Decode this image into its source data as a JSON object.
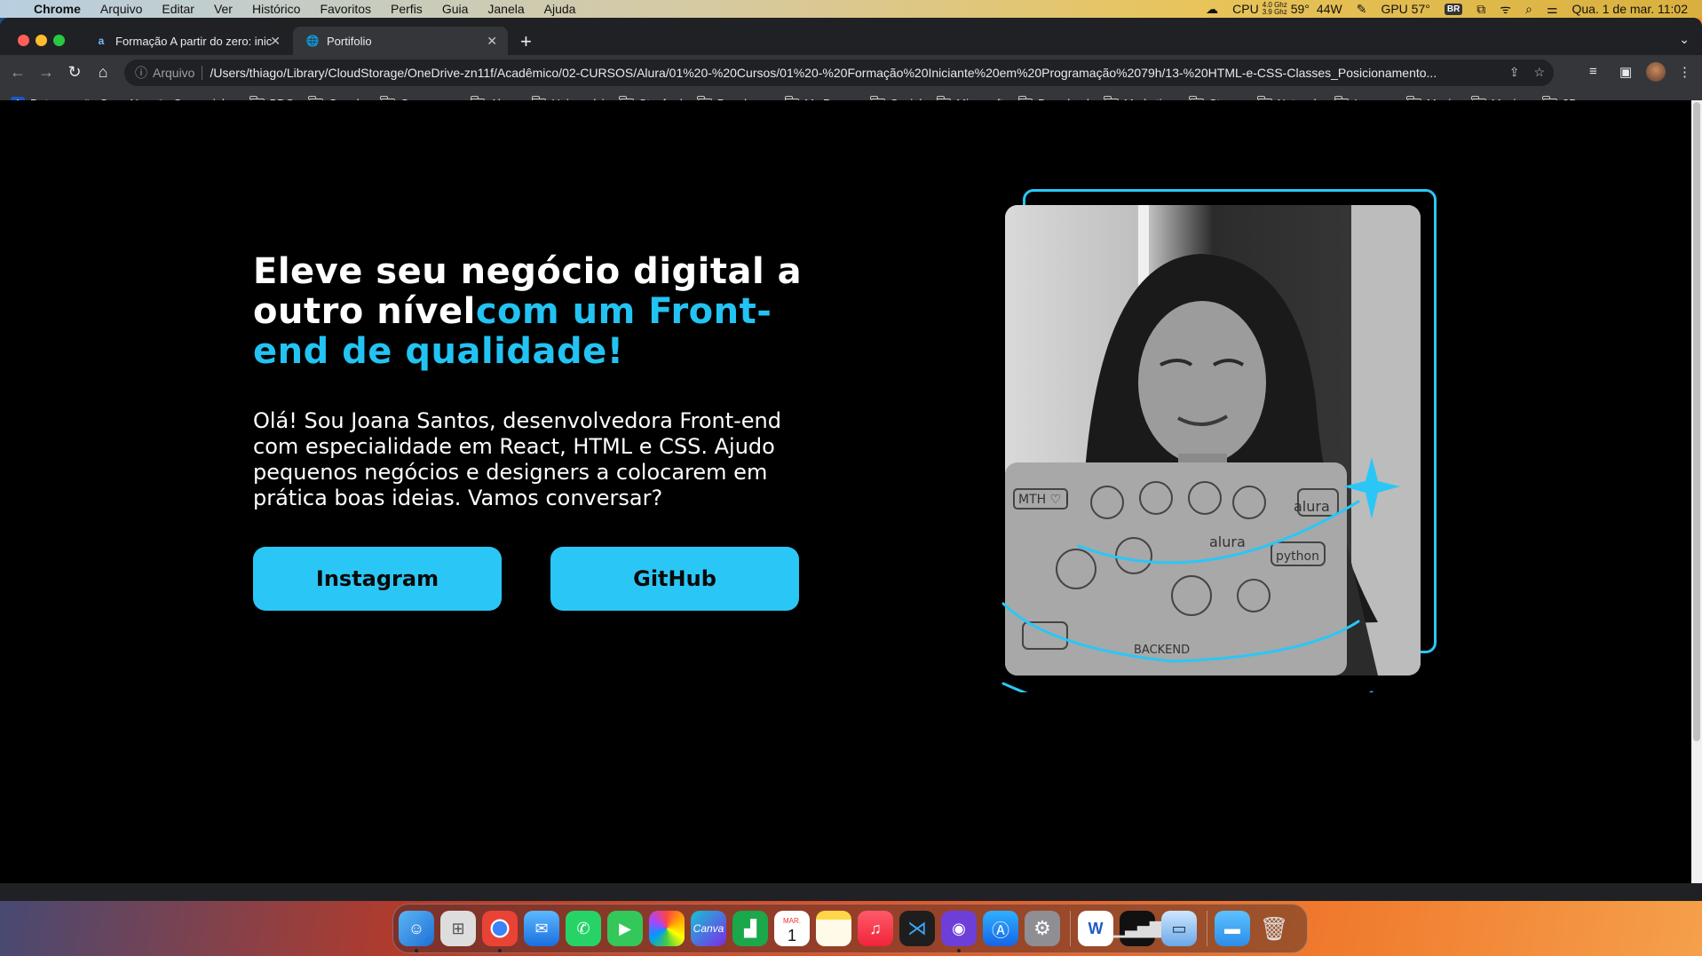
{
  "menubar": {
    "app": "Chrome",
    "menus": [
      "Arquivo",
      "Editar",
      "Ver",
      "Histórico",
      "Favoritos",
      "Perfis",
      "Guia",
      "Janela",
      "Ajuda"
    ],
    "cpu_label": "CPU",
    "cpu_freq_top": "4.0 Ghz",
    "cpu_freq_bottom": "3.9 Ghz",
    "cpu_temp": "59°",
    "power": "44W",
    "gpu_label": "GPU",
    "gpu_temp": "57°",
    "keyboard": "BR",
    "datetime": "Qua. 1 de mar.  11:02"
  },
  "tabs": [
    {
      "title": "Formação A partir do zero: inic",
      "icon": "a"
    },
    {
      "title": "Portifolio",
      "icon": "globe"
    }
  ],
  "omnibox": {
    "scheme_label": "Arquivo",
    "url": "/Users/thiago/Library/CloudStorage/OneDrive-zn11f/Acadêmico/02-CURSOS/Alura/01%20-%20Cursos/01%20-%20Formação%20Iniciante%20em%20Programação%2079h/13-%20HTML-e-CSS-Classes_Posicionamento..."
  },
  "bookmarks": [
    "Detran",
    "OpenAI",
    "Cavaquinho",
    "BDC",
    "Google",
    "Concursos",
    "Alura",
    "Uniasselvi",
    "Stanford",
    "Developer",
    "My Pages",
    "Social",
    "Microsoft",
    "Download",
    "Marketing",
    "Steam",
    "Network",
    "Images",
    "Music",
    "Movies",
    "3D"
  ],
  "hero": {
    "headline_white": "Eleve seu negócio digital a outro nível",
    "headline_blue": "com um Front-end de qualidade!",
    "bio": "Olá! Sou Joana Santos, desenvolvedora Front-end com especialidade em React, HTML e CSS. Ajudo pequenos negócios e designers a colocarem em prática boas ideias. Vamos conversar?",
    "btn_instagram": "Instagram",
    "btn_github": "GitHub"
  },
  "dock": {
    "calendar_month": "MAR.",
    "calendar_day": "1",
    "apps": [
      "finder",
      "launchpad",
      "chrome",
      "mail",
      "whatsapp",
      "facetime",
      "photos",
      "canva",
      "numbers",
      "calendar",
      "notes",
      "music",
      "vscode",
      "github-desktop",
      "app-store",
      "system-settings",
      "word",
      "activity-monitor",
      "preview",
      "downloads",
      "trash"
    ]
  },
  "colors": {
    "accent": "#22c3f3",
    "button": "#2ac7f6",
    "page_bg": "#000000"
  }
}
